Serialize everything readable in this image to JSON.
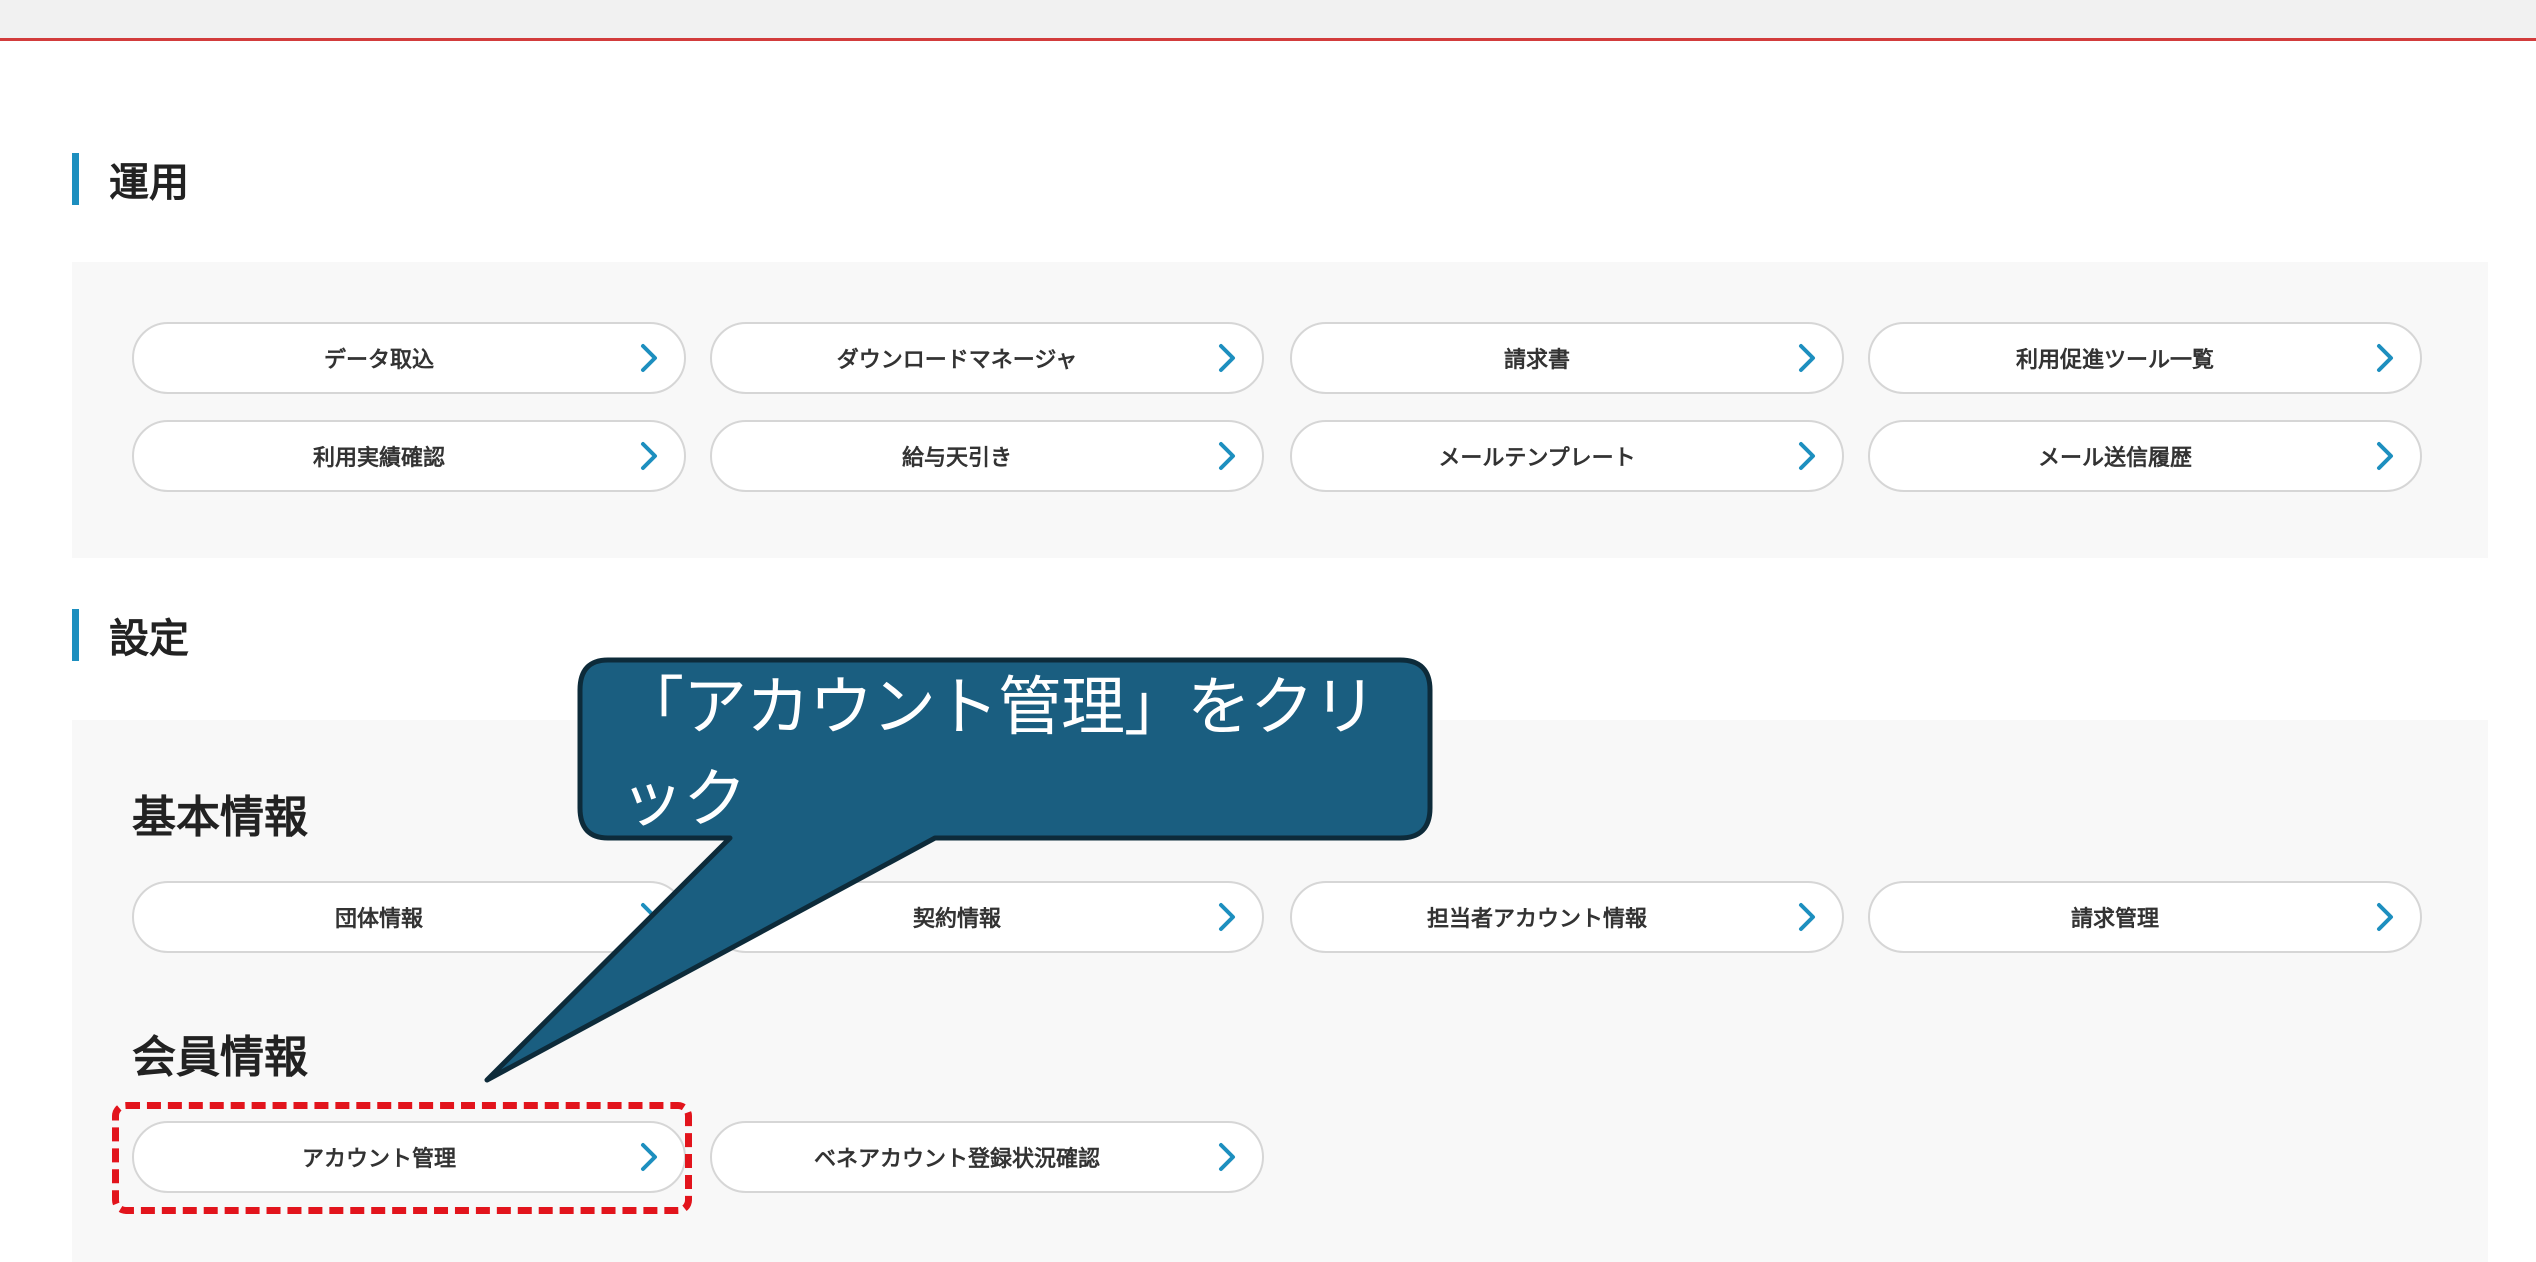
{
  "sections": {
    "operations": {
      "title": "運用"
    },
    "settings": {
      "title": "設定"
    }
  },
  "subsections": {
    "basic_info": {
      "title": "基本情報"
    },
    "member_info": {
      "title": "会員情報"
    }
  },
  "operations_buttons": [
    "データ取込",
    "ダウンロードマネージャ",
    "請求書",
    "利用促進ツール一覧",
    "利用実績確認",
    "給与天引き",
    "メールテンプレート",
    "メール送信履歴"
  ],
  "basic_info_buttons": [
    "団体情報",
    "契約情報",
    "担当者アカウント情報",
    "請求管理"
  ],
  "member_info_buttons": [
    "アカウント管理",
    "ベネアカウント登録状況確認"
  ],
  "callout": {
    "text": "「アカウント管理」をクリック"
  },
  "colors": {
    "accent_bar": "#1d8fbf",
    "chevron": "#1d8fbf",
    "callout_fill": "#1a5e80",
    "highlight_border": "#e2141c",
    "topbar_line": "#d23c3c"
  },
  "icons": {
    "chevron": "chevron-right-icon"
  }
}
